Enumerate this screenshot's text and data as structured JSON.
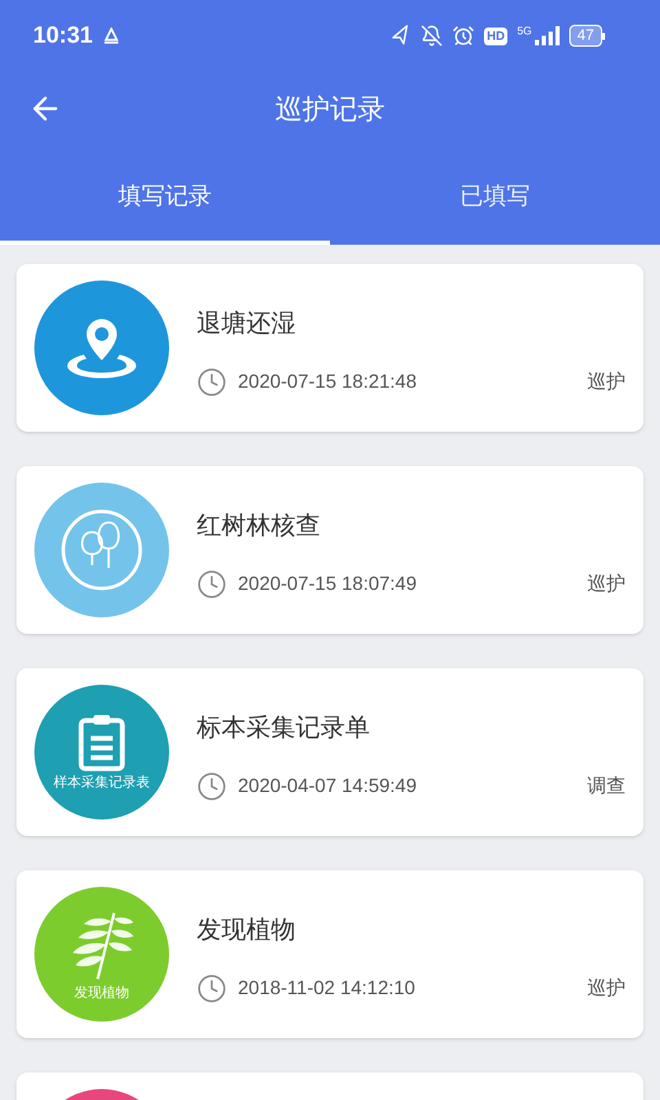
{
  "status_bar": {
    "time": "10:31",
    "hd": "HD",
    "network": "5G",
    "battery": "47"
  },
  "header": {
    "title": "巡护记录"
  },
  "tabs": [
    {
      "label": "填写记录",
      "selected": true
    },
    {
      "label": "已填写",
      "selected": false
    }
  ],
  "records": [
    {
      "kind": "pin",
      "color": "#1e96dc",
      "title": "退塘还湿",
      "time": "2020-07-15 18:21:48",
      "tag": "巡护"
    },
    {
      "kind": "trees",
      "color": "#74c3ea",
      "title": "红树林核查",
      "time": "2020-07-15 18:07:49",
      "tag": "巡护"
    },
    {
      "kind": "clipboard",
      "color": "#1e9fb2",
      "icon_label": "样本采集记录表",
      "title": "标本采集记录单",
      "time": "2020-04-07 14:59:49",
      "tag": "调查"
    },
    {
      "kind": "leaf",
      "color": "#7dcc2d",
      "icon_label": "发现植物",
      "title": "发现植物",
      "time": "2018-11-02 14:12:10",
      "tag": "巡护"
    },
    {
      "kind": "blank",
      "color": "#e8467c"
    }
  ]
}
